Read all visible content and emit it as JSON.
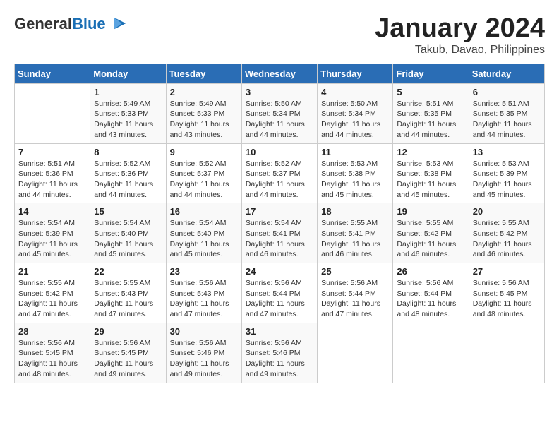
{
  "logo": {
    "general": "General",
    "blue": "Blue"
  },
  "header": {
    "month": "January 2024",
    "location": "Takub, Davao, Philippines"
  },
  "weekdays": [
    "Sunday",
    "Monday",
    "Tuesday",
    "Wednesday",
    "Thursday",
    "Friday",
    "Saturday"
  ],
  "weeks": [
    [
      {
        "day": "",
        "info": ""
      },
      {
        "day": "1",
        "info": "Sunrise: 5:49 AM\nSunset: 5:33 PM\nDaylight: 11 hours\nand 43 minutes."
      },
      {
        "day": "2",
        "info": "Sunrise: 5:49 AM\nSunset: 5:33 PM\nDaylight: 11 hours\nand 43 minutes."
      },
      {
        "day": "3",
        "info": "Sunrise: 5:50 AM\nSunset: 5:34 PM\nDaylight: 11 hours\nand 44 minutes."
      },
      {
        "day": "4",
        "info": "Sunrise: 5:50 AM\nSunset: 5:34 PM\nDaylight: 11 hours\nand 44 minutes."
      },
      {
        "day": "5",
        "info": "Sunrise: 5:51 AM\nSunset: 5:35 PM\nDaylight: 11 hours\nand 44 minutes."
      },
      {
        "day": "6",
        "info": "Sunrise: 5:51 AM\nSunset: 5:35 PM\nDaylight: 11 hours\nand 44 minutes."
      }
    ],
    [
      {
        "day": "7",
        "info": "Sunrise: 5:51 AM\nSunset: 5:36 PM\nDaylight: 11 hours\nand 44 minutes."
      },
      {
        "day": "8",
        "info": "Sunrise: 5:52 AM\nSunset: 5:36 PM\nDaylight: 11 hours\nand 44 minutes."
      },
      {
        "day": "9",
        "info": "Sunrise: 5:52 AM\nSunset: 5:37 PM\nDaylight: 11 hours\nand 44 minutes."
      },
      {
        "day": "10",
        "info": "Sunrise: 5:52 AM\nSunset: 5:37 PM\nDaylight: 11 hours\nand 44 minutes."
      },
      {
        "day": "11",
        "info": "Sunrise: 5:53 AM\nSunset: 5:38 PM\nDaylight: 11 hours\nand 45 minutes."
      },
      {
        "day": "12",
        "info": "Sunrise: 5:53 AM\nSunset: 5:38 PM\nDaylight: 11 hours\nand 45 minutes."
      },
      {
        "day": "13",
        "info": "Sunrise: 5:53 AM\nSunset: 5:39 PM\nDaylight: 11 hours\nand 45 minutes."
      }
    ],
    [
      {
        "day": "14",
        "info": "Sunrise: 5:54 AM\nSunset: 5:39 PM\nDaylight: 11 hours\nand 45 minutes."
      },
      {
        "day": "15",
        "info": "Sunrise: 5:54 AM\nSunset: 5:40 PM\nDaylight: 11 hours\nand 45 minutes."
      },
      {
        "day": "16",
        "info": "Sunrise: 5:54 AM\nSunset: 5:40 PM\nDaylight: 11 hours\nand 45 minutes."
      },
      {
        "day": "17",
        "info": "Sunrise: 5:54 AM\nSunset: 5:41 PM\nDaylight: 11 hours\nand 46 minutes."
      },
      {
        "day": "18",
        "info": "Sunrise: 5:55 AM\nSunset: 5:41 PM\nDaylight: 11 hours\nand 46 minutes."
      },
      {
        "day": "19",
        "info": "Sunrise: 5:55 AM\nSunset: 5:42 PM\nDaylight: 11 hours\nand 46 minutes."
      },
      {
        "day": "20",
        "info": "Sunrise: 5:55 AM\nSunset: 5:42 PM\nDaylight: 11 hours\nand 46 minutes."
      }
    ],
    [
      {
        "day": "21",
        "info": "Sunrise: 5:55 AM\nSunset: 5:42 PM\nDaylight: 11 hours\nand 47 minutes."
      },
      {
        "day": "22",
        "info": "Sunrise: 5:55 AM\nSunset: 5:43 PM\nDaylight: 11 hours\nand 47 minutes."
      },
      {
        "day": "23",
        "info": "Sunrise: 5:56 AM\nSunset: 5:43 PM\nDaylight: 11 hours\nand 47 minutes."
      },
      {
        "day": "24",
        "info": "Sunrise: 5:56 AM\nSunset: 5:44 PM\nDaylight: 11 hours\nand 47 minutes."
      },
      {
        "day": "25",
        "info": "Sunrise: 5:56 AM\nSunset: 5:44 PM\nDaylight: 11 hours\nand 47 minutes."
      },
      {
        "day": "26",
        "info": "Sunrise: 5:56 AM\nSunset: 5:44 PM\nDaylight: 11 hours\nand 48 minutes."
      },
      {
        "day": "27",
        "info": "Sunrise: 5:56 AM\nSunset: 5:45 PM\nDaylight: 11 hours\nand 48 minutes."
      }
    ],
    [
      {
        "day": "28",
        "info": "Sunrise: 5:56 AM\nSunset: 5:45 PM\nDaylight: 11 hours\nand 48 minutes."
      },
      {
        "day": "29",
        "info": "Sunrise: 5:56 AM\nSunset: 5:45 PM\nDaylight: 11 hours\nand 49 minutes."
      },
      {
        "day": "30",
        "info": "Sunrise: 5:56 AM\nSunset: 5:46 PM\nDaylight: 11 hours\nand 49 minutes."
      },
      {
        "day": "31",
        "info": "Sunrise: 5:56 AM\nSunset: 5:46 PM\nDaylight: 11 hours\nand 49 minutes."
      },
      {
        "day": "",
        "info": ""
      },
      {
        "day": "",
        "info": ""
      },
      {
        "day": "",
        "info": ""
      }
    ]
  ]
}
